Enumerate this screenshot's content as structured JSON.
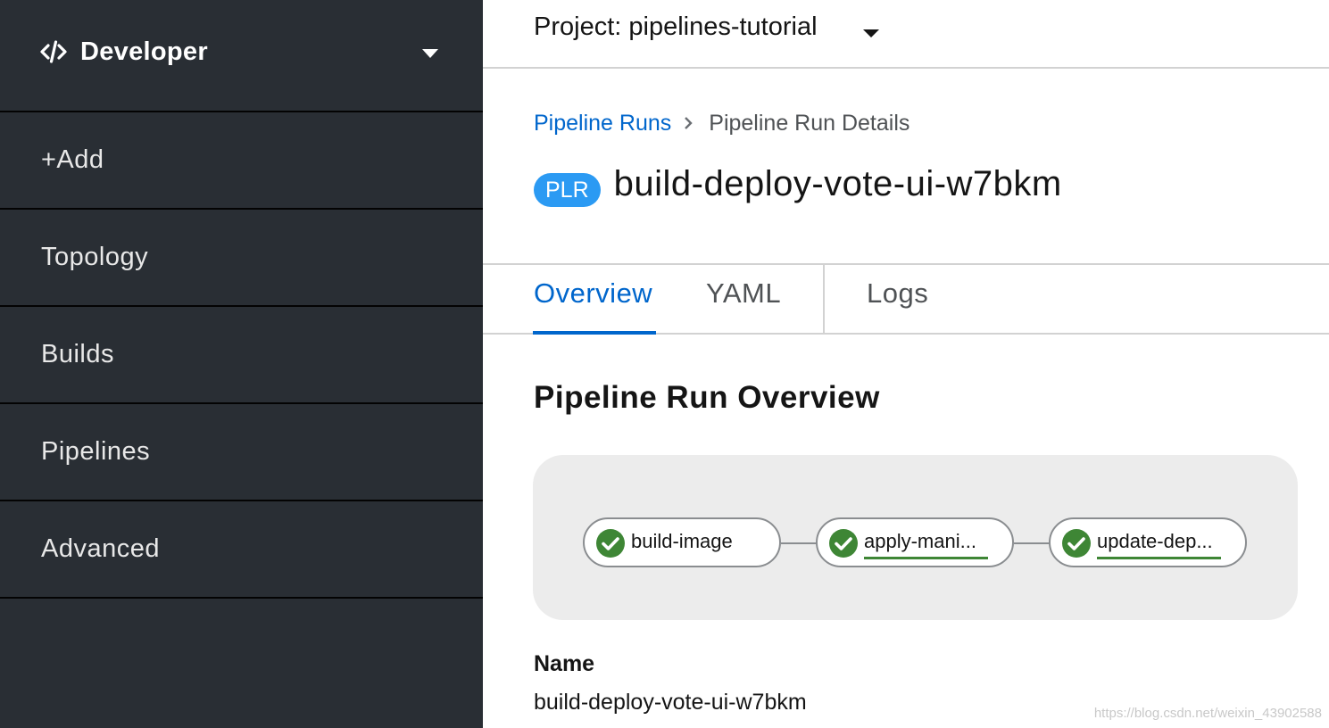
{
  "sidebar": {
    "perspective": {
      "icon": "code-icon",
      "label": "Developer"
    },
    "items": [
      {
        "label": "+Add"
      },
      {
        "label": "Topology"
      },
      {
        "label": "Builds"
      },
      {
        "label": "Pipelines"
      },
      {
        "label": "Advanced"
      }
    ],
    "colors": {
      "background": "#292e34",
      "divider": "#030303"
    }
  },
  "header": {
    "project_label": "Project: pipelines-tutorial"
  },
  "breadcrumb": {
    "parent": "Pipeline Runs",
    "current": "Pipeline Run Details"
  },
  "title": {
    "badge": "PLR",
    "name": "build-deploy-vote-ui-w7bkm"
  },
  "tabs": [
    {
      "label": "Overview",
      "active": true
    },
    {
      "label": "YAML",
      "active": false
    },
    {
      "label": "Logs",
      "active": false
    }
  ],
  "overview": {
    "section_title": "Pipeline Run Overview",
    "pipeline_graph": {
      "tasks": [
        {
          "label": "build-image",
          "status": "succeeded",
          "icon": "check-circle-icon"
        },
        {
          "label": "apply-mani...",
          "status": "succeeded",
          "icon": "check-circle-icon"
        },
        {
          "label": "update-dep...",
          "status": "succeeded",
          "icon": "check-circle-icon"
        }
      ]
    },
    "fields": {
      "name_label": "Name",
      "name_value": "build-deploy-vote-ui-w7bkm"
    }
  },
  "watermark": "https://blog.csdn.net/weixin_43902588",
  "colors": {
    "link": "#0066cc",
    "badge": "#2b9af3",
    "success": "#3e8635",
    "graph_bg": "#ececec"
  }
}
